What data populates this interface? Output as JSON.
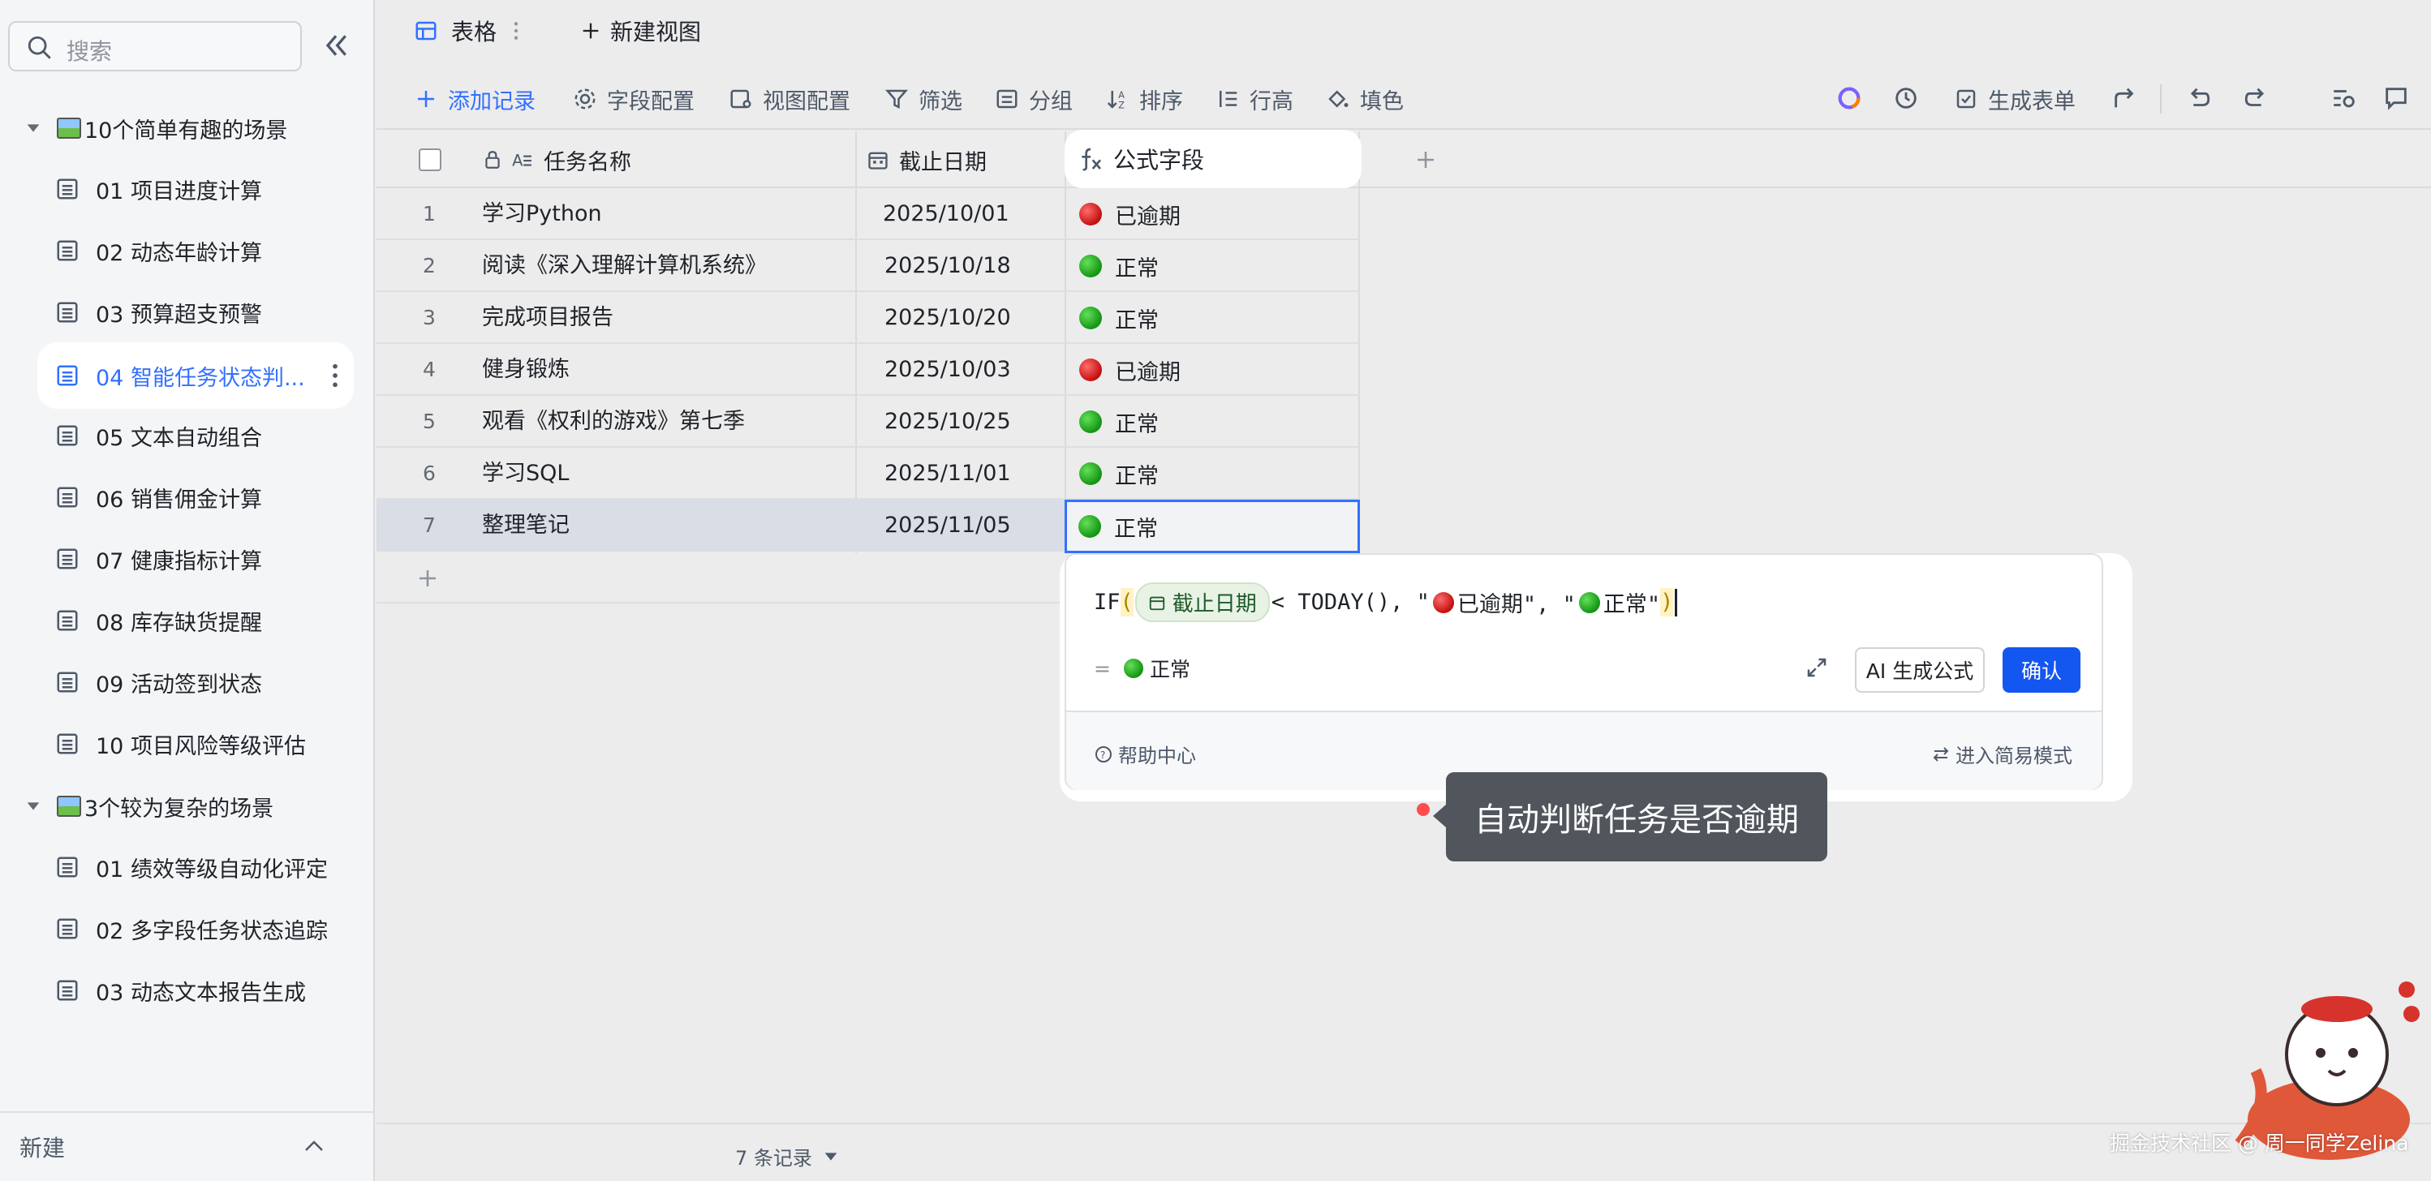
{
  "sidebar": {
    "search_placeholder": "搜索",
    "groups": [
      {
        "title": "10个简单有趣的场景",
        "items": [
          {
            "label": "01 项目进度计算"
          },
          {
            "label": "02 动态年龄计算"
          },
          {
            "label": "03 预算超支预警"
          },
          {
            "label": "04 智能任务状态判..."
          },
          {
            "label": "05 文本自动组合"
          },
          {
            "label": "06 销售佣金计算"
          },
          {
            "label": "07 健康指标计算"
          },
          {
            "label": "08 库存缺货提醒"
          },
          {
            "label": "09 活动签到状态"
          },
          {
            "label": "10 项目风险等级评估"
          }
        ]
      },
      {
        "title": "3个较为复杂的场景",
        "items": [
          {
            "label": "01 绩效等级自动化评定"
          },
          {
            "label": "02 多字段任务状态追踪"
          },
          {
            "label": "03 动态文本报告生成"
          }
        ]
      }
    ],
    "footer_label": "新建"
  },
  "tabs": [
    {
      "label": "表格"
    },
    {
      "label": "新建视图"
    }
  ],
  "toolbar": {
    "add_record": "添加记录",
    "field_config": "字段配置",
    "view_config": "视图配置",
    "filter": "筛选",
    "group": "分组",
    "sort": "排序",
    "row_height": "行高",
    "fill_color": "填色",
    "generate_form": "生成表单"
  },
  "table": {
    "headers": [
      "任务名称",
      "截止日期",
      "公式字段"
    ],
    "rows": [
      {
        "num": "1",
        "name": "学习Python",
        "date": "2025/10/01",
        "status": "已逾期",
        "color": "red"
      },
      {
        "num": "2",
        "name": "阅读《深入理解计算机系统》",
        "date": "2025/10/18",
        "status": "正常",
        "color": "green"
      },
      {
        "num": "3",
        "name": "完成项目报告",
        "date": "2025/10/20",
        "status": "正常",
        "color": "green"
      },
      {
        "num": "4",
        "name": "健身锻炼",
        "date": "2025/10/03",
        "status": "已逾期",
        "color": "red"
      },
      {
        "num": "5",
        "name": "观看《权利的游戏》第七季",
        "date": "2025/10/25",
        "status": "正常",
        "color": "green"
      },
      {
        "num": "6",
        "name": "学习SQL",
        "date": "2025/11/01",
        "status": "正常",
        "color": "green"
      },
      {
        "num": "7",
        "name": "整理笔记",
        "date": "2025/11/05",
        "status": "正常",
        "color": "green"
      }
    ],
    "record_count": "7 条记录"
  },
  "formula": {
    "prefix": "IF",
    "field_chip": "截止日期",
    "middle": "< TODAY(), \"",
    "overdue_text": " 已逾期\", \"",
    "normal_text": " 正常\"",
    "result_eq": "=",
    "result_text": "正常",
    "ai_button": "AI 生成公式",
    "confirm_button": "确认",
    "help": "帮助中心",
    "simple_mode": "进入简易模式"
  },
  "tooltip": "自动判断任务是否逾期",
  "watermark": "掘金技术社区 @ 周一同学Zelina",
  "colors": {
    "accent": "#3370ff",
    "confirm": "#1456f0",
    "overdue": "#c20f0f",
    "normal": "#139413"
  }
}
